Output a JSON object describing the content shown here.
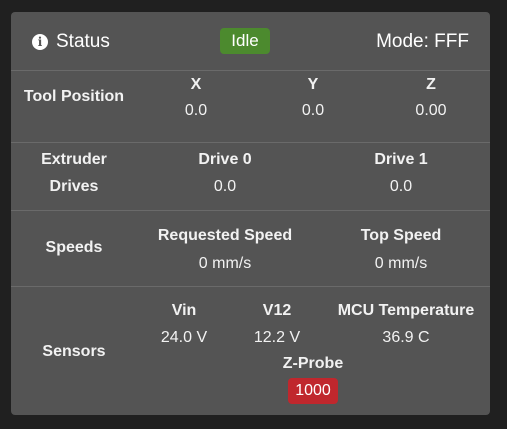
{
  "header": {
    "title": "Status",
    "status": "Idle",
    "mode": "Mode: FFF"
  },
  "tool_position": {
    "label": "Tool Position",
    "axes": [
      {
        "name": "X",
        "value": "0.0"
      },
      {
        "name": "Y",
        "value": "0.0"
      },
      {
        "name": "Z",
        "value": "0.00"
      }
    ]
  },
  "extruder": {
    "label_line1": "Extruder",
    "label_line2": "Drives",
    "drives": [
      {
        "name": "Drive 0",
        "value": "0.0"
      },
      {
        "name": "Drive 1",
        "value": "0.0"
      }
    ]
  },
  "speeds": {
    "label": "Speeds",
    "requested": {
      "name": "Requested Speed",
      "value": "0 mm/s"
    },
    "top": {
      "name": "Top Speed",
      "value": "0 mm/s"
    }
  },
  "sensors": {
    "label": "Sensors",
    "items": [
      {
        "name": "Vin",
        "value": "24.0 V"
      },
      {
        "name": "V12",
        "value": "12.2 V"
      },
      {
        "name": "MCU Temperature",
        "value": "36.9 C"
      }
    ],
    "probe": {
      "name": "Z-Probe",
      "value": "1000"
    }
  },
  "colors": {
    "card": "#545454",
    "idle_badge": "#4c8a2e",
    "probe_badge": "#c0272d"
  },
  "icons": {
    "status": "info-icon"
  }
}
